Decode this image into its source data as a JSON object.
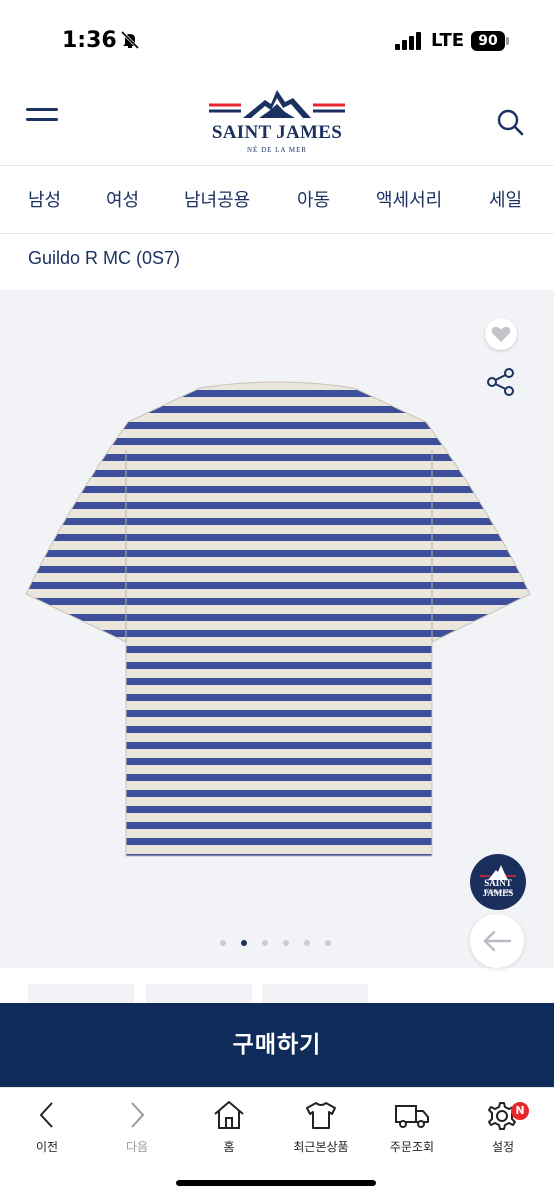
{
  "status_bar": {
    "time": "1:36",
    "network": "LTE",
    "battery": "90"
  },
  "header": {
    "brand": "SAINT JAMES",
    "tagline": "NÉ DE LA MER"
  },
  "categories": [
    "남성",
    "여성",
    "남녀공용",
    "아동",
    "액세서리",
    "세일"
  ],
  "product": {
    "title": "Guildo R MC (0S7)"
  },
  "gallery": {
    "badge_text": "SAINT JAMES",
    "badge_sub": "NÉ DE LA MER",
    "dot_count": 6,
    "active_dot": 2
  },
  "colors": {
    "navy": "#0f2b5a",
    "stripe": "#3d4e9a",
    "shirt_base": "#ebe6dd",
    "accent_red": "#e8262b"
  },
  "buy_button": "구매하기",
  "bottom_nav": [
    {
      "label": "이전",
      "icon": "chevron-left-icon"
    },
    {
      "label": "다음",
      "icon": "chevron-right-icon"
    },
    {
      "label": "홈",
      "icon": "home-icon"
    },
    {
      "label": "최근본상품",
      "icon": "tshirt-icon"
    },
    {
      "label": "주문조회",
      "icon": "truck-icon"
    },
    {
      "label": "설정",
      "icon": "gear-icon",
      "badge": "N"
    }
  ]
}
